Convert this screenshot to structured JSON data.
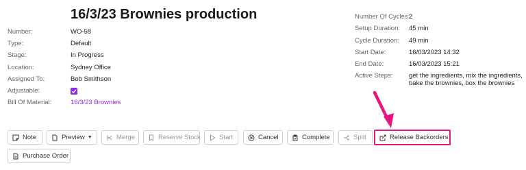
{
  "title": "16/3/23 Brownies production",
  "fields": [
    {
      "label": "Number:",
      "value": "WO-58"
    },
    {
      "label": "Type:",
      "value": "Default"
    },
    {
      "label": "Stage:",
      "value": "In Progress"
    },
    {
      "label": "Location:",
      "value": "Sydney Office"
    },
    {
      "label": "Assigned To:",
      "value": "Bob Smithson"
    },
    {
      "label": "Adjustable:",
      "value": ""
    },
    {
      "label": "Bill Of Material:",
      "value": "16/3/23 Brownies"
    }
  ],
  "adjustable_checked": true,
  "right_fields": [
    {
      "label": "Number Of Cycles:",
      "value": "2"
    },
    {
      "label": "Setup Duration:",
      "value": "45 min"
    },
    {
      "label": "Cycle Duration:",
      "value": "49 min"
    },
    {
      "label": "Start Date:",
      "value": "16/03/2023 14:32"
    },
    {
      "label": "End Date:",
      "value": "16/03/2023 15:21"
    },
    {
      "label": "Active Steps:",
      "value": "get the ingredients, mix the ingredients, bake the brownies, box the brownies"
    }
  ],
  "buttons": {
    "note": "Note",
    "preview": "Preview",
    "merge": "Merge",
    "reserve_stock": "Reserve Stock",
    "start": "Start",
    "cancel": "Cancel",
    "complete": "Complete",
    "split": "Split",
    "release_backorders": "Release Backorders",
    "purchase_order": "Purchase Order"
  },
  "colors": {
    "accent": "#8b2be2",
    "highlight": "#e6157f"
  }
}
